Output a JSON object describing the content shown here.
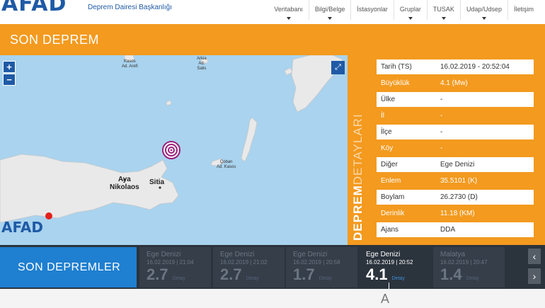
{
  "header": {
    "logo": "AFAD",
    "subtitle": "Deprem Dairesi Başkanlığı",
    "nav": [
      {
        "label": "Veritabanı",
        "caret": true
      },
      {
        "label": "Bilgi/Belge",
        "caret": true
      },
      {
        "label": "İstasyonlar",
        "caret": false
      },
      {
        "label": "Gruplar",
        "caret": true
      },
      {
        "label": "TUSAK",
        "caret": true
      },
      {
        "label": "Udap/Udsep",
        "caret": true
      },
      {
        "label": "İletişim",
        "caret": false
      }
    ]
  },
  "band": {
    "title": "SON DEPREM"
  },
  "map": {
    "zoom_in": "+",
    "zoom_out": "−",
    "fullscreen_icon": "expand-icon",
    "labels": {
      "lbl1": "Kasos\nAd. Arefi",
      "lbl2": "Arkia\nAd.\nSalis",
      "lbl3": "Çoban\nAd. Kasos"
    },
    "cities": {
      "aya_nikolaos": "Aya\nNikolaos",
      "sitia": "Sitia"
    },
    "logo": "AFAD",
    "colors": {
      "sea": "#a9d3ee",
      "land": "#e9e9ea",
      "marker": "#9b1f7e"
    }
  },
  "details_label": {
    "bold": "DEPREM",
    "light": "DETAYLARI"
  },
  "details": [
    {
      "label": "Tarih (TS)",
      "value": "16.02.2019 - 20:52:04"
    },
    {
      "label": "Büyüklük",
      "value": "4.1 (Mw)"
    },
    {
      "label": "Ülke",
      "value": "-"
    },
    {
      "label": "İl",
      "value": "-"
    },
    {
      "label": "İlçe",
      "value": "-"
    },
    {
      "label": "Köy",
      "value": "-"
    },
    {
      "label": "Diğer",
      "value": "Ege Denizi"
    },
    {
      "label": "Enlem",
      "value": "35.5101 (K)"
    },
    {
      "label": "Boylam",
      "value": "26.2730 (D)"
    },
    {
      "label": "Derinlik",
      "value": "11.18 (KM)"
    },
    {
      "label": "Ajans",
      "value": "DDA"
    }
  ],
  "recent": {
    "title": "SON DEPREMLER",
    "items": [
      {
        "location": "Ege Denizi",
        "time": "16.02.2019 | 21:04",
        "magnitude": "2.7",
        "link": "Detay"
      },
      {
        "location": "Ege Denizi",
        "time": "16.02.2019 | 21:02",
        "magnitude": "2.7",
        "link": "Detay"
      },
      {
        "location": "Ege Denizi",
        "time": "16.02.2019 | 20:58",
        "magnitude": "1.7",
        "link": "Detay"
      },
      {
        "location": "Ege Denizi",
        "time": "16.02.2019 | 20:52",
        "magnitude": "4.1",
        "link": "Detay"
      },
      {
        "location": "Malatya",
        "time": "16.02.2019 | 20:47",
        "magnitude": "1.4",
        "link": "Detay"
      }
    ],
    "active_index": 3,
    "prev_icon": "‹",
    "next_icon": "›"
  },
  "bottom": {
    "glyph": "A"
  },
  "colors": {
    "brand_blue": "#1f5aa6",
    "orange": "#f39a1f",
    "strip_dark": "#2b333d"
  }
}
